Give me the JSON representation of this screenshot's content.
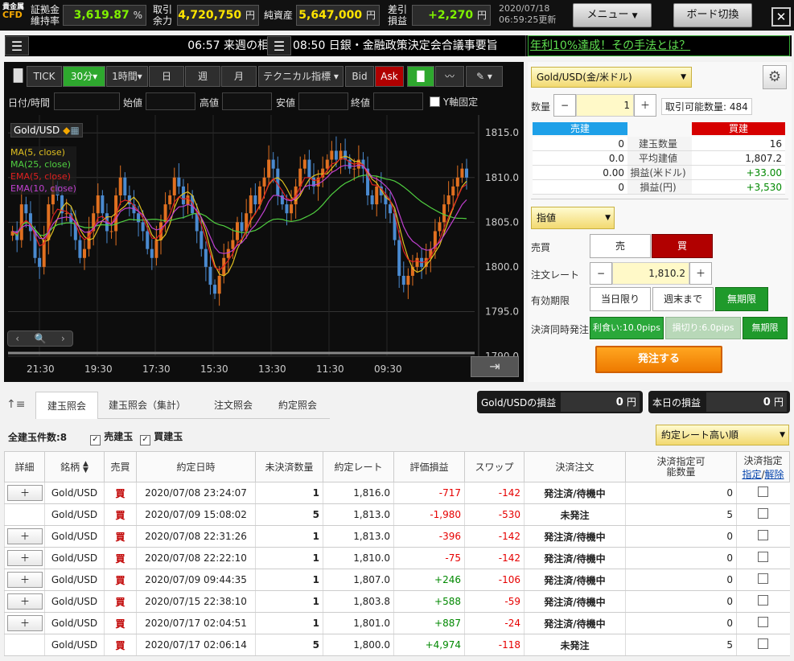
{
  "header": {
    "logo_top": "貴金属",
    "logo_bottom": "CFD",
    "m1_label_a": "証拠金",
    "m1_label_b": "維持率",
    "m1_value": "3,619.87",
    "m1_unit": "%",
    "m2_label_a": "取引",
    "m2_label_b": "余力",
    "m2_value": "4,720,750",
    "m2_unit": "円",
    "m3_label": "純資産",
    "m3_value": "5,647,000",
    "m3_unit": "円",
    "m4_label_a": "差引",
    "m4_label_b": "損益",
    "m4_value": "+2,270",
    "m4_unit": "円",
    "date": "2020/07/18",
    "time": "06:59:25更新",
    "menu_label": "メニュー",
    "board_label": "ボード切換",
    "close_label": "✕"
  },
  "ticker": {
    "item1": "06:57 来週の相",
    "item2": "08:50 日銀・金融政策決定会合議事要旨",
    "ad": "年利10%達成！その手法とは？"
  },
  "chart_toolbar": {
    "tick": "TICK",
    "min30": "30分",
    "hour1": "1時間",
    "day": "日",
    "week": "週",
    "month": "月",
    "tech": "テクニカル指標",
    "bid": "Bid",
    "ask": "Ask"
  },
  "chart_fields": {
    "datetime": "日付/時間",
    "open": "始値",
    "high": "高値",
    "low": "安値",
    "close": "終値",
    "yfix": "Y軸固定"
  },
  "chart_data": {
    "type": "candlestick",
    "symbol": "Gold/USD",
    "legend": [
      "MA(5, close)",
      "MA(25, close)",
      "EMA(5, close)",
      "EMA(10, close)"
    ],
    "colors": {
      "ma5": "#e0c020",
      "ma25": "#50d040",
      "ema5": "#e02020",
      "ema10": "#c040d0",
      "up": "#e07020",
      "down": "#4a8ad0"
    },
    "y_ticks": [
      "1815.0",
      "1810.0",
      "1805.0",
      "1800.0",
      "1795.0",
      "1790.0"
    ],
    "ylim": [
      1790,
      1817
    ],
    "x_ticks": [
      "21:30",
      "19:30",
      "17:30",
      "15:30",
      "13:30",
      "11:30",
      "09:30"
    ],
    "close": [
      1804,
      1803,
      1807,
      1806,
      1804,
      1801,
      1800,
      1803,
      1807,
      1809,
      1808,
      1806,
      1806,
      1805,
      1803,
      1801,
      1802,
      1804,
      1806,
      1808,
      1806,
      1804,
      1804,
      1808,
      1810,
      1808,
      1807,
      1806,
      1805,
      1804,
      1802,
      1801,
      1803,
      1805,
      1807,
      1808,
      1810,
      1809,
      1807,
      1808,
      1806,
      1804,
      1802,
      1800,
      1798,
      1797,
      1799,
      1801,
      1802,
      1803,
      1805,
      1804,
      1806,
      1808,
      1807,
      1809,
      1810,
      1812,
      1811,
      1808,
      1807,
      1806,
      1807,
      1809,
      1811,
      1812,
      1810,
      1809,
      1810,
      1811,
      1812,
      1813,
      1812,
      1813,
      1812,
      1811,
      1811,
      1812,
      1811,
      1808,
      1807,
      1809,
      1808,
      1807,
      1806,
      1803,
      1799,
      1798,
      1799,
      1800,
      1801,
      1800,
      1801,
      1802,
      1804,
      1805,
      1807,
      1808,
      1809,
      1810,
      1811,
      1810
    ]
  },
  "order": {
    "symbol": "Gold/USD(金/米ドル)",
    "qty_label": "数量",
    "qty": "1",
    "minus": "−",
    "plus": "＋",
    "available": "取引可能数量: 484",
    "sell_head": "売建",
    "buy_head": "買建",
    "rows": [
      {
        "label": "建玉数量",
        "sell": "0",
        "buy": "16"
      },
      {
        "label": "平均建値",
        "sell": "0.0",
        "buy": "1,807.2"
      },
      {
        "label": "損益(米ドル)",
        "sell": "0.00",
        "buy": "+33.00"
      },
      {
        "label": "損益(円)",
        "sell": "0",
        "buy": "+3,530"
      }
    ],
    "type": "指値",
    "side_label": "売買",
    "sell": "売",
    "buy": "買",
    "rate_label": "注文レート",
    "rate": "1,810.2",
    "exp_label": "有効期限",
    "exp1": "当日限り",
    "exp2": "週末まで",
    "exp3": "無期限",
    "settle_label": "決済同時発注",
    "tp": "利食い:10.0pips",
    "sl": "損切り:6.0pips",
    "settle_exp": "無期限",
    "submit": "発注する"
  },
  "tabs": {
    "t1": "建玉照会",
    "t2": "建玉照会（集計）",
    "t3": "注文照会",
    "t4": "約定照会"
  },
  "pl": {
    "sym_label": "Gold/USDの損益",
    "sym_value": "0",
    "sym_unit": "円",
    "day_label": "本日の損益",
    "day_value": "0",
    "day_unit": "円"
  },
  "filter": {
    "count": "全建玉件数:8",
    "sell": "売建玉",
    "buy": "買建玉",
    "sort": "約定レート高い順"
  },
  "table": {
    "headers": [
      "詳細",
      "銘柄",
      "売買",
      "約定日時",
      "未決済数量",
      "約定レート",
      "評価損益",
      "スワップ",
      "決済注文",
      "決済指定可能数量",
      "決済指定"
    ],
    "h_spec": "指定",
    "h_release": "解除",
    "rows": [
      {
        "detail": "＋",
        "sym": "Gold/USD",
        "side": "買",
        "dt": "2020/07/08 23:24:07",
        "qty": "1",
        "rate": "1,816.0",
        "pl": "-717",
        "swap": "-142",
        "order": "発注済/待機中",
        "avail": "0"
      },
      {
        "detail": "",
        "sym": "Gold/USD",
        "side": "買",
        "dt": "2020/07/09 15:08:02",
        "qty": "5",
        "rate": "1,813.0",
        "pl": "-1,980",
        "swap": "-530",
        "order": "未発注",
        "avail": "5"
      },
      {
        "detail": "＋",
        "sym": "Gold/USD",
        "side": "買",
        "dt": "2020/07/08 22:31:26",
        "qty": "1",
        "rate": "1,813.0",
        "pl": "-396",
        "swap": "-142",
        "order": "発注済/待機中",
        "avail": "0"
      },
      {
        "detail": "＋",
        "sym": "Gold/USD",
        "side": "買",
        "dt": "2020/07/08 22:22:10",
        "qty": "1",
        "rate": "1,810.0",
        "pl": "-75",
        "swap": "-142",
        "order": "発注済/待機中",
        "avail": "0"
      },
      {
        "detail": "＋",
        "sym": "Gold/USD",
        "side": "買",
        "dt": "2020/07/09 09:44:35",
        "qty": "1",
        "rate": "1,807.0",
        "pl": "+246",
        "swap": "-106",
        "order": "発注済/待機中",
        "avail": "0"
      },
      {
        "detail": "＋",
        "sym": "Gold/USD",
        "side": "買",
        "dt": "2020/07/15 22:38:10",
        "qty": "1",
        "rate": "1,803.8",
        "pl": "+588",
        "swap": "-59",
        "order": "発注済/待機中",
        "avail": "0"
      },
      {
        "detail": "＋",
        "sym": "Gold/USD",
        "side": "買",
        "dt": "2020/07/17 02:04:51",
        "qty": "1",
        "rate": "1,801.0",
        "pl": "+887",
        "swap": "-24",
        "order": "発注済/待機中",
        "avail": "0"
      },
      {
        "detail": "",
        "sym": "Gold/USD",
        "side": "買",
        "dt": "2020/07/17 02:06:14",
        "qty": "5",
        "rate": "1,800.0",
        "pl": "+4,974",
        "swap": "-118",
        "order": "未発注",
        "avail": "5"
      }
    ]
  }
}
